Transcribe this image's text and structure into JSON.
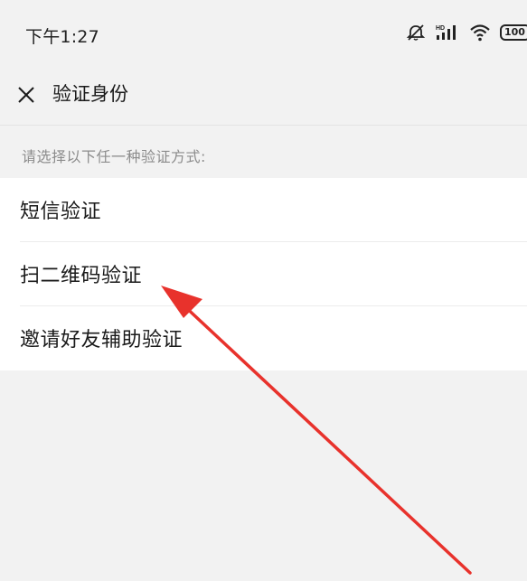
{
  "status_bar": {
    "time": "下午1:27",
    "icons": [
      "alarm-off-icon",
      "hd-signal-icon",
      "wifi-icon",
      "battery-icon"
    ],
    "battery_text": "100"
  },
  "nav": {
    "close_icon": "close-icon",
    "title": "验证身份"
  },
  "hint": "请选择以下任一种验证方式:",
  "options": [
    {
      "label": "短信验证"
    },
    {
      "label": "扫二维码验证"
    },
    {
      "label": "邀请好友辅助验证"
    }
  ],
  "colors": {
    "background": "#f2f2f2",
    "card": "#ffffff",
    "annotation_arrow": "#e8322c"
  }
}
